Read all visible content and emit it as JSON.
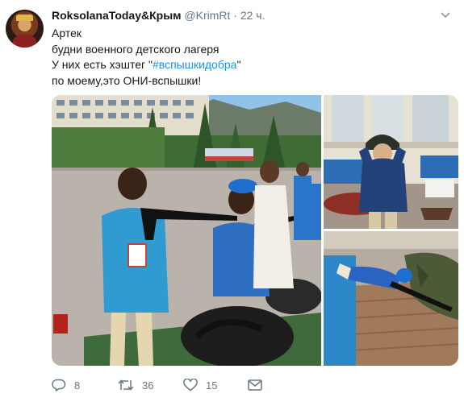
{
  "tweet": {
    "author": {
      "name": "RoksolanaToday&Крым",
      "handle": "@KrimRt",
      "time": "22 ч.",
      "avatar_icon": "avatar-portrait-icon"
    },
    "lines": [
      "Артек",
      "будни военного детского лагеря",
      "У них есть хэштег \"",
      "#вспышкидобра",
      "\"",
      "по моему,это ОНИ-вспышки!"
    ],
    "hashtag_color": "#1b95e0",
    "media": {
      "photos": [
        {
          "name": "photo-children-with-rifle",
          "scene": "children-with-rifles-outdoors"
        },
        {
          "name": "photo-boy-in-helmet",
          "scene": "boy-in-helmet-indoors"
        },
        {
          "name": "photo-boy-prone-with-rifle",
          "scene": "boy-lying-with-rifle"
        }
      ]
    },
    "actions": {
      "reply": {
        "icon": "reply-icon",
        "count": "8"
      },
      "retweet": {
        "icon": "retweet-icon",
        "count": "36"
      },
      "like": {
        "icon": "heart-icon",
        "count": "15"
      },
      "message": {
        "icon": "envelope-icon",
        "count": ""
      }
    },
    "colors": {
      "text": "#14171a",
      "secondary": "#657786",
      "link": "#1b95e0"
    }
  }
}
